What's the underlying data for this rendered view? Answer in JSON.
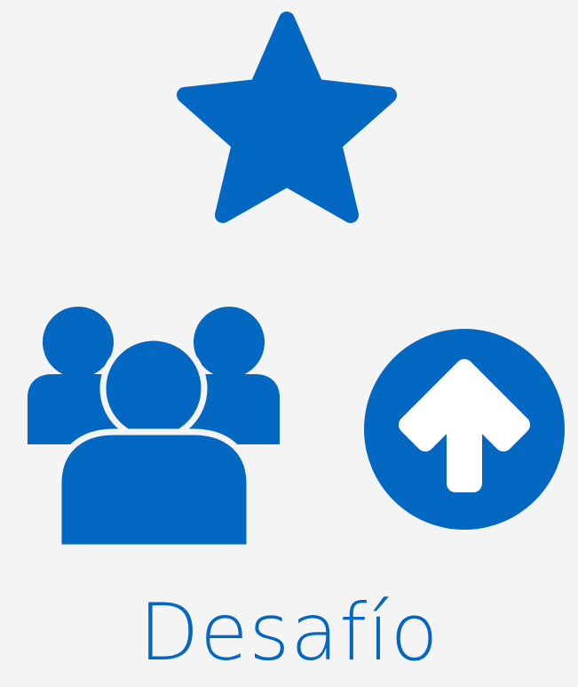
{
  "accent_color": "#0467c2",
  "background_color": "#f4f4f4",
  "icons": [
    "star-icon",
    "group-of-people-icon",
    "circle-arrow-up-icon"
  ],
  "caption": "Desafío"
}
